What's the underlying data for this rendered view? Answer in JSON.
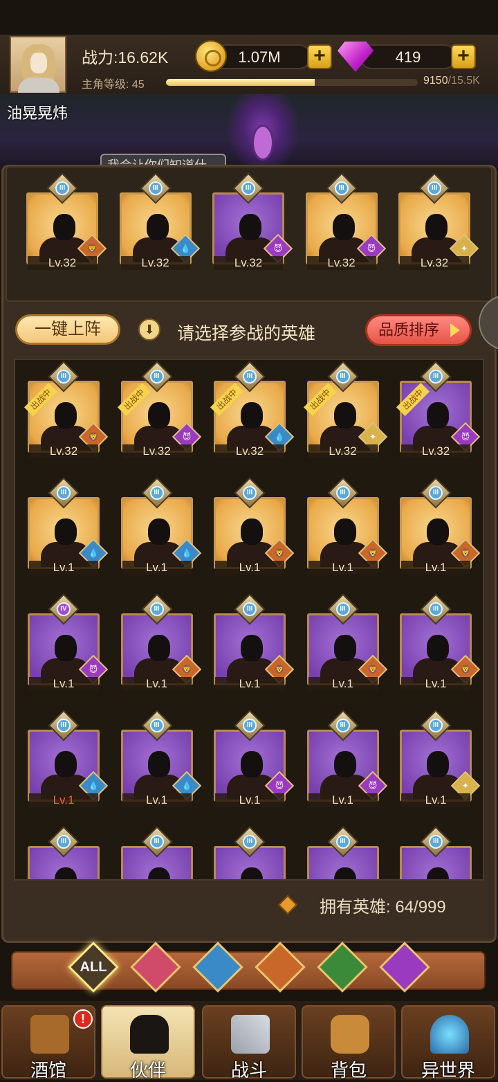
{
  "header": {
    "power_label": "战力:16.62K",
    "level_label": "主角等级: 45",
    "xp_current": "9150",
    "xp_max": "/15.5K",
    "xp_fraction": 0.59,
    "gold": "1.07M",
    "gems": "419",
    "player_name": "油晃晃炜",
    "scene_bubble": "我会让你们知道什"
  },
  "team": [
    {
      "lv": "Lv.32",
      "frame": "gold",
      "faction": "lion",
      "rank": "III"
    },
    {
      "lv": "Lv.32",
      "frame": "gold",
      "faction": "water",
      "rank": "III"
    },
    {
      "lv": "Lv.32",
      "frame": "purple",
      "faction": "demon",
      "rank": "III"
    },
    {
      "lv": "Lv.32",
      "frame": "gold",
      "faction": "demon",
      "rank": "III"
    },
    {
      "lv": "Lv.32",
      "frame": "gold",
      "faction": "elf",
      "rank": "III"
    }
  ],
  "controls": {
    "auto_deploy": "一键上阵",
    "hint": "请选择参战的英雄",
    "sort": "品质排序",
    "deployed_tag": "出战中"
  },
  "heroes": [
    {
      "lv": "Lv.32",
      "frame": "gold",
      "faction": "lion",
      "rank": "III",
      "deployed": true
    },
    {
      "lv": "Lv.32",
      "frame": "gold",
      "faction": "demon",
      "rank": "III",
      "deployed": true
    },
    {
      "lv": "Lv.32",
      "frame": "gold",
      "faction": "water",
      "rank": "III",
      "deployed": true
    },
    {
      "lv": "Lv.32",
      "frame": "gold",
      "faction": "elf",
      "rank": "III",
      "deployed": true
    },
    {
      "lv": "Lv.32",
      "frame": "purple",
      "faction": "demon",
      "rank": "III",
      "deployed": true
    },
    {
      "lv": "Lv.1",
      "frame": "gold",
      "faction": "water",
      "rank": "III"
    },
    {
      "lv": "Lv.1",
      "frame": "gold",
      "faction": "water",
      "rank": "III"
    },
    {
      "lv": "Lv.1",
      "frame": "gold",
      "faction": "lion",
      "rank": "III"
    },
    {
      "lv": "Lv.1",
      "frame": "gold",
      "faction": "lion",
      "rank": "III"
    },
    {
      "lv": "Lv.1",
      "frame": "gold",
      "faction": "lion",
      "rank": "III"
    },
    {
      "lv": "Lv.1",
      "frame": "purple",
      "faction": "demon",
      "rank": "IV"
    },
    {
      "lv": "Lv.1",
      "frame": "purple",
      "faction": "lion",
      "rank": "III"
    },
    {
      "lv": "Lv.1",
      "frame": "purple",
      "faction": "lion",
      "rank": "III"
    },
    {
      "lv": "Lv.1",
      "frame": "purple",
      "faction": "lion",
      "rank": "III"
    },
    {
      "lv": "Lv.1",
      "frame": "purple",
      "faction": "lion",
      "rank": "III"
    },
    {
      "lv": "Lv.1",
      "frame": "purple",
      "faction": "water",
      "rank": "III",
      "lv_red": true
    },
    {
      "lv": "Lv.1",
      "frame": "purple",
      "faction": "water",
      "rank": "III"
    },
    {
      "lv": "Lv.1",
      "frame": "purple",
      "faction": "demon",
      "rank": "III"
    },
    {
      "lv": "Lv.1",
      "frame": "purple",
      "faction": "demon",
      "rank": "III"
    },
    {
      "lv": "Lv.1",
      "frame": "purple",
      "faction": "elf",
      "rank": "III"
    },
    {
      "lv": "",
      "frame": "purple",
      "faction": "",
      "rank": "III"
    },
    {
      "lv": "",
      "frame": "purple",
      "faction": "",
      "rank": "III"
    },
    {
      "lv": "",
      "frame": "purple",
      "faction": "",
      "rank": "III"
    },
    {
      "lv": "",
      "frame": "purple",
      "faction": "",
      "rank": "III"
    },
    {
      "lv": "",
      "frame": "purple",
      "faction": "",
      "rank": "III"
    }
  ],
  "owned": "拥有英雄: 64/999",
  "filters": [
    {
      "id": "all",
      "label": "ALL",
      "color": "#4a3a28",
      "active": true
    },
    {
      "id": "knight",
      "label": "",
      "color": "#d04a6a"
    },
    {
      "id": "water",
      "label": "",
      "color": "#3a8ac8"
    },
    {
      "id": "lion",
      "label": "",
      "color": "#c9672a"
    },
    {
      "id": "elf",
      "label": "",
      "color": "#3a8a3a"
    },
    {
      "id": "demon",
      "label": "",
      "color": "#9a3ac0"
    }
  ],
  "nav": {
    "tavern": "酒馆",
    "partner": "伙伴",
    "battle": "战斗",
    "bag": "背包",
    "otherworld": "异世界",
    "tavern_badge": "!"
  },
  "colors": {
    "accent_gold": "#e7c65a",
    "sort_red": "#e55448",
    "frame_purple": "#7840ae",
    "frame_gold": "#e9a949"
  }
}
